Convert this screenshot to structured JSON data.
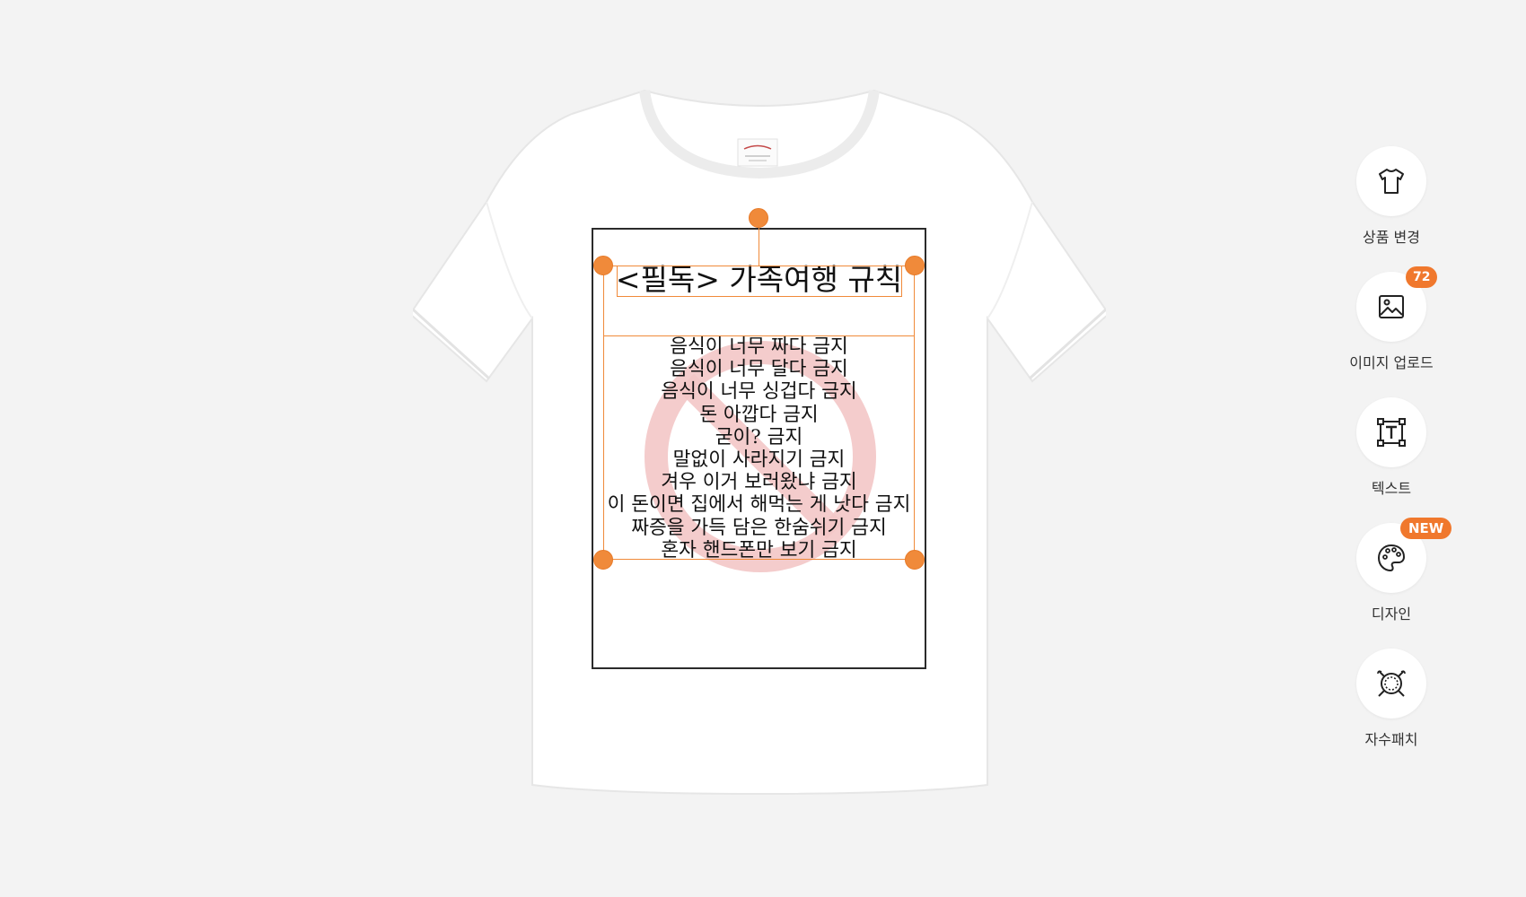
{
  "design": {
    "title": "<필독> 가족여행 규칙",
    "rules": [
      "음식이 너무 짜다 금지",
      "음식이 너무 달다 금지",
      "음식이 너무 싱겁다 금지",
      "돈 아깝다 금지",
      "굳이? 금지",
      "말없이 사라지기 금지",
      "겨우 이거 보러왔냐 금지",
      "이 돈이면 집에서 해먹는 게 낫다 금지",
      "짜증을 가득 담은 한숨쉬기 금지",
      "혼자 핸드폰만 보기 금지"
    ]
  },
  "toolbar": {
    "items": [
      {
        "label": "상품 변경",
        "icon": "tshirt-icon"
      },
      {
        "label": "이미지 업로드",
        "icon": "image-icon",
        "badge": "72"
      },
      {
        "label": "텍스트",
        "icon": "text-frame-icon"
      },
      {
        "label": "디자인",
        "icon": "palette-icon",
        "badge": "NEW"
      },
      {
        "label": "자수패치",
        "icon": "embroidery-patch-icon"
      }
    ]
  },
  "colors": {
    "selection": "#f08a3a",
    "badge": "#f0782d",
    "background": "#f3f3f3",
    "ban_mark": "#f3c7c7"
  }
}
